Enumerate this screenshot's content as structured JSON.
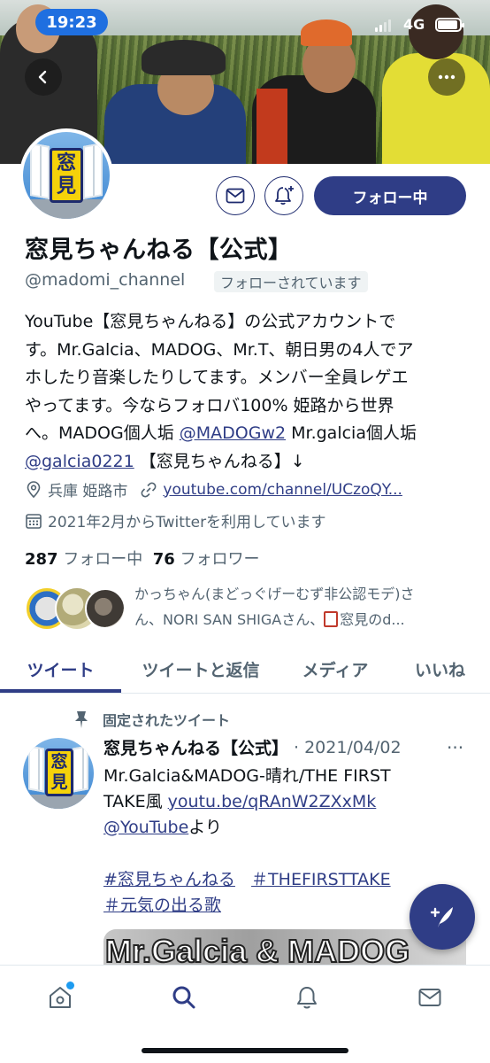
{
  "status_bar": {
    "time": "19:23",
    "network": "4G"
  },
  "profile": {
    "name": "窓見ちゃんねる【公式】",
    "handle": "@madomi_channel",
    "follows_you_badge": "フォローされています",
    "follow_button": "フォロー中",
    "avatar_text": [
      "窓",
      "見"
    ],
    "bio_lines": [
      "YouTube【窓見ちゃんねる】の公式アカウントで",
      "す。Mr.Galcia、MADOG、Mr.T、朝日男の4人でア",
      "ホしたり音楽したりしてます。メンバー全員レゲエ",
      "やってます。今ならフォロバ100% 姫路から世界",
      "へ。MADOG個人垢 ",
      "@MADOGw2",
      " Mr.galcia個人垢",
      "@galcia0221",
      " 【窓見ちゃんねる】↓"
    ],
    "location": "兵庫 姫路市",
    "website": "youtube.com/channel/UCzoQY...",
    "joined": "2021年2月からTwitterを利用しています",
    "following_count": "287",
    "following_label": "フォロー中",
    "followers_count": "76",
    "followers_label": "フォロワー",
    "mutual_lines": [
      "かっちゃん(まどっぐげーむず非公認モデ)さ",
      "ん、NORI SAN SHIGAさん、",
      "窓見のd..."
    ]
  },
  "tabs": [
    "ツイート",
    "ツイートと返信",
    "メディア",
    "いいね"
  ],
  "tweet": {
    "pinned_label": "固定されたツイート",
    "author": "窓見ちゃんねる【公式】",
    "date": "· 2021/04/02",
    "more": "···",
    "body_line1": "Mr.Galcia&MADOG-晴れ/THE FIRST",
    "body_line2_text": "TAKE風 ",
    "body_line2_link": "youtu.be/qRAnW2ZXxMk",
    "body_line3_link": "@YouTube",
    "body_line3_text": "より",
    "hashtag1": "#窓見ちゃんねる",
    "hashtag2": "＃THEFIRSTTAKE",
    "hashtag3": "＃元気の出る歌",
    "thumbnail_text": "Mr.Galcia & MADOG"
  },
  "colors": {
    "accent": "#2f3d86",
    "secondary_text": "#536471",
    "notification_dot": "#1d9bf0"
  }
}
